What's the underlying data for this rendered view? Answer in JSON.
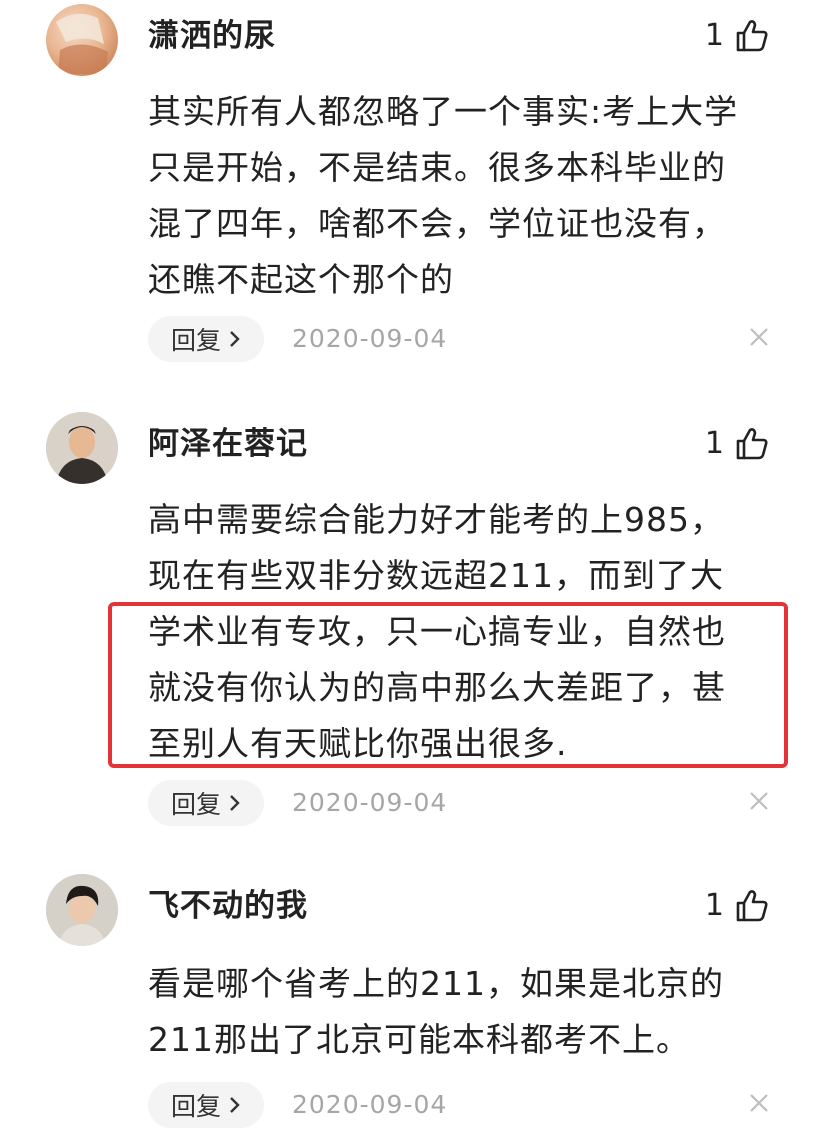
{
  "comments": [
    {
      "username": "潇洒的尿",
      "likes": "1",
      "lines": [
        "其实所有人都忽略了一个事实:考上大学",
        "只是开始，不是结束。很多本科毕业的",
        "混了四年，啥都不会，学位证也没有，",
        "还瞧不起这个那个的"
      ],
      "reply_label": "回复",
      "date": "2020-09-04",
      "avatar_icon": "avatar-icon"
    },
    {
      "username": "阿泽在蓉记",
      "likes": "1",
      "lines": [
        "高中需要综合能力好才能考的上985，",
        "现在有些双非分数远超211，而到了大",
        "学术业有专攻，只一心搞专业，自然也",
        "就没有你认为的高中那么大差距了，甚",
        "至别人有天赋比你强出很多."
      ],
      "reply_label": "回复",
      "date": "2020-09-04",
      "avatar_icon": "avatar-icon"
    },
    {
      "username": "飞不动的我",
      "likes": "1",
      "lines": [
        "看是哪个省考上的211，如果是北京的",
        "211那出了北京可能本科都考不上。"
      ],
      "reply_label": "回复",
      "date": "2020-09-04",
      "avatar_icon": "avatar-icon"
    }
  ],
  "icons": {
    "like": "thumbs-up-icon",
    "close": "close-icon",
    "chevron": "chevron-right-icon"
  },
  "colors": {
    "highlight_border": "#e3343a",
    "date": "#a6a6a6",
    "reply_bg": "#f4f4f4"
  }
}
